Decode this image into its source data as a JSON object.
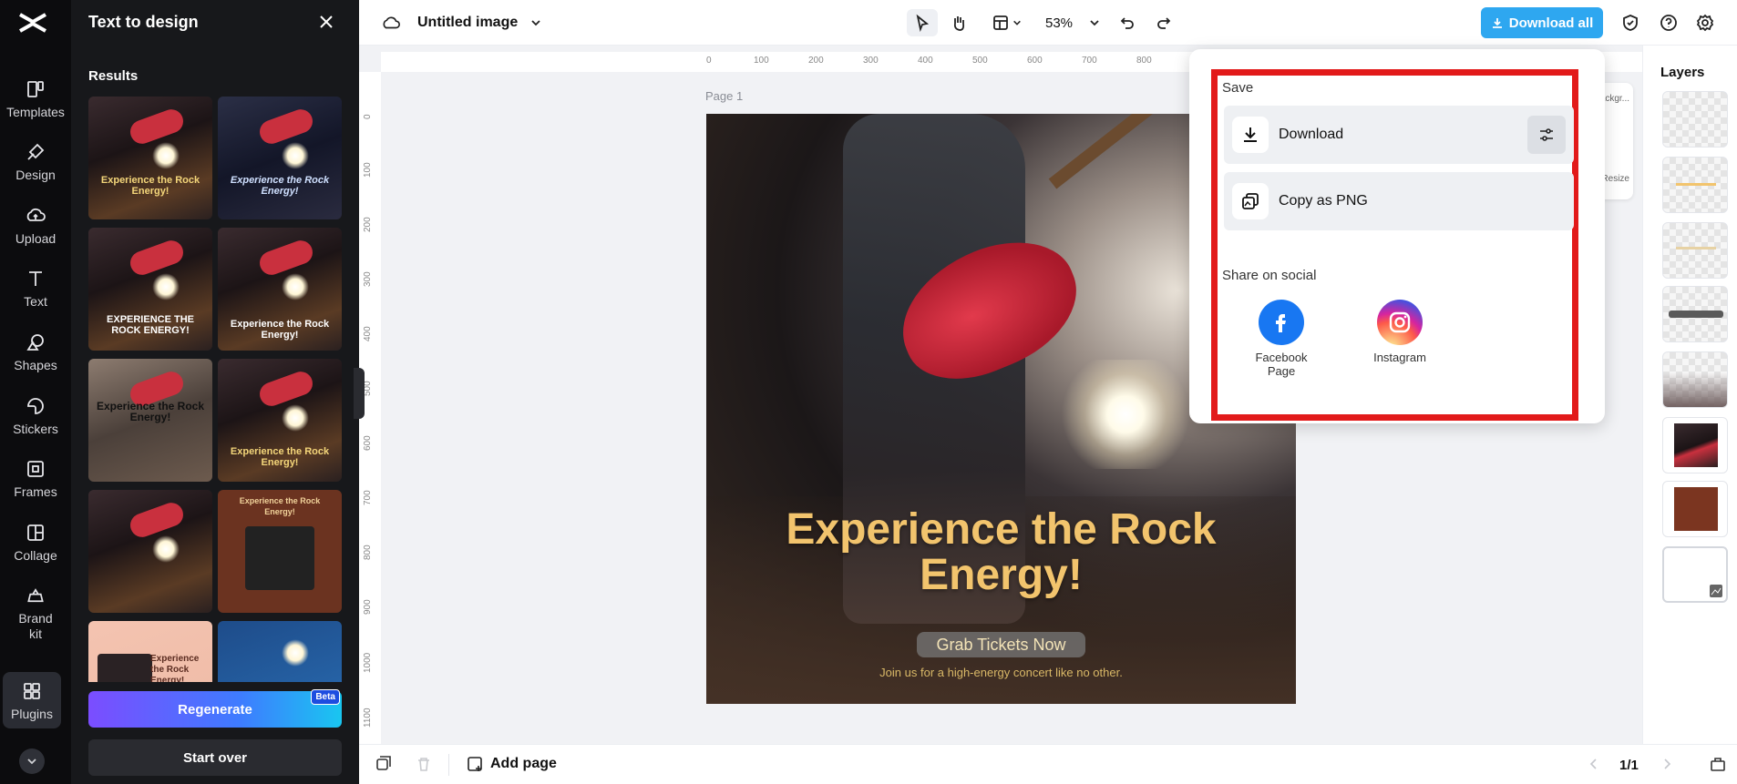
{
  "rail": {
    "items": [
      {
        "label": "Templates",
        "icon": "templates-icon"
      },
      {
        "label": "Design",
        "icon": "design-icon"
      },
      {
        "label": "Upload",
        "icon": "upload-icon"
      },
      {
        "label": "Text",
        "icon": "text-icon"
      },
      {
        "label": "Shapes",
        "icon": "shapes-icon"
      },
      {
        "label": "Stickers",
        "icon": "stickers-icon"
      },
      {
        "label": "Frames",
        "icon": "frames-icon"
      },
      {
        "label": "Collage",
        "icon": "collage-icon"
      },
      {
        "label": "Brand kit",
        "icon": "brand-kit-icon"
      },
      {
        "label": "Plugins",
        "icon": "plugins-icon"
      }
    ]
  },
  "panel": {
    "title": "Text to design",
    "results_label": "Results",
    "thumbs": [
      {
        "caption": "Experience the Rock Energy!"
      },
      {
        "caption": "Experience the Rock Energy!"
      },
      {
        "caption": "EXPERIENCE THE ROCK ENERGY!"
      },
      {
        "caption": "Experience the Rock Energy!"
      },
      {
        "caption": "Experience the Rock Energy!"
      },
      {
        "caption": "Experience the Rock Energy!"
      },
      {
        "caption": ""
      },
      {
        "caption": "Experience the Rock Energy!"
      },
      {
        "caption": "Experience the Rock Energy!"
      },
      {
        "caption": ""
      }
    ],
    "regenerate_label": "Regenerate",
    "beta_label": "Beta",
    "start_over_label": "Start over"
  },
  "topbar": {
    "doc_title": "Untitled image",
    "zoom": "53%",
    "download_all_label": "Download all"
  },
  "ruler": {
    "h_ticks": [
      "0",
      "100",
      "200",
      "300",
      "400",
      "500",
      "600",
      "700",
      "800"
    ],
    "v_ticks": [
      "0",
      "100",
      "200",
      "300",
      "400",
      "500",
      "600",
      "700",
      "800",
      "900",
      "1000",
      "1100"
    ]
  },
  "canvas": {
    "page_label": "Page 1",
    "headline": "Experience the Rock Energy!",
    "cta": "Grab Tickets Now",
    "subtext": "Join us for a high-energy concert like no other."
  },
  "side_tools": {
    "bg_label": "Backgr...",
    "resize_label": "Resize"
  },
  "layers": {
    "title": "Layers"
  },
  "bottombar": {
    "add_page_label": "Add page",
    "page_counter": "1/1"
  },
  "popover": {
    "save_heading": "Save",
    "download_label": "Download",
    "copy_png_label": "Copy as PNG",
    "share_heading": "Share on social",
    "facebook_label": "Facebook Page",
    "instagram_label": "Instagram"
  },
  "colors": {
    "accent": "#2ea7f0",
    "highlight_border": "#e21a1a",
    "headline": "#f2c46d"
  }
}
